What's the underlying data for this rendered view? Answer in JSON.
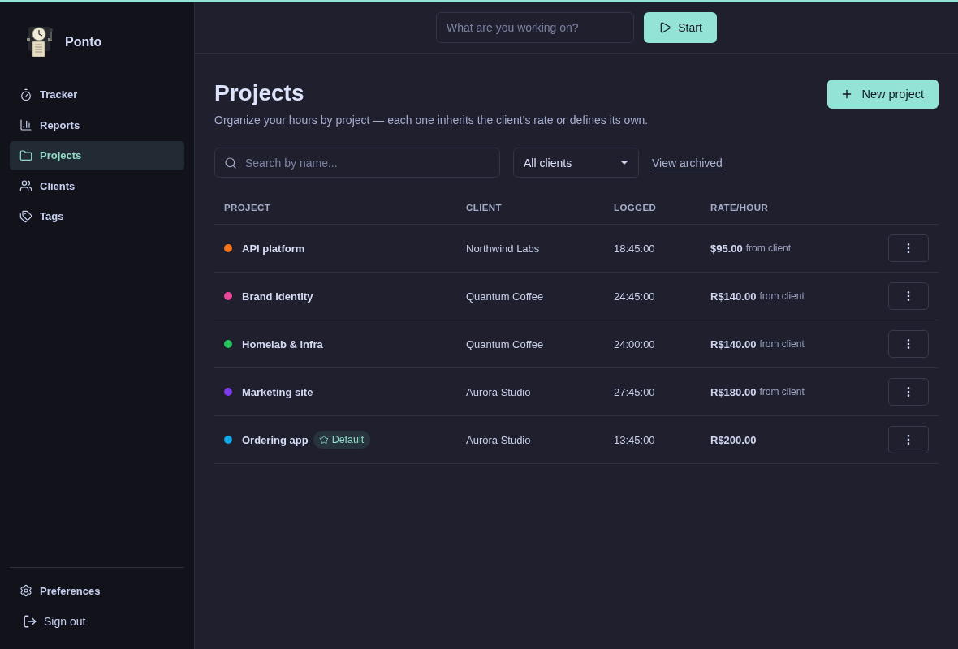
{
  "top_bar": {
    "task_placeholder": "What are you working on?",
    "start_button": "Start"
  },
  "sidebar": {
    "app_name": "Ponto",
    "items": [
      {
        "label": "Tracker",
        "selected": false
      },
      {
        "label": "Reports",
        "selected": false
      },
      {
        "label": "Projects",
        "selected": true
      },
      {
        "label": "Clients",
        "selected": false
      },
      {
        "label": "Tags",
        "selected": false
      }
    ],
    "preferences": "Preferences",
    "sign_out": "Sign out"
  },
  "page": {
    "title": "Projects",
    "subtitle": "Organize your hours by project — each one inherits the client's rate or defines its own.",
    "new_button": "New project"
  },
  "filters": {
    "search_placeholder": "Search by name...",
    "client_filter": "All clients",
    "archived_link": "View archived"
  },
  "table": {
    "columns": [
      "PROJECT",
      "CLIENT",
      "LOGGED",
      "RATE/HOUR"
    ],
    "rows": [
      {
        "name": "API platform",
        "color": "#f97316",
        "client": "Northwind Labs",
        "logged": "18:45:00",
        "rate": "$95.00",
        "rate_note": "from client"
      },
      {
        "name": "Brand identity",
        "color": "#ec4899",
        "client": "Quantum Coffee",
        "logged": "24:45:00",
        "rate": "R$140.00",
        "rate_note": "from client"
      },
      {
        "name": "Homelab & infra",
        "color": "#22c55e",
        "client": "Quantum Coffee",
        "logged": "24:00:00",
        "rate": "R$140.00",
        "rate_note": "from client"
      },
      {
        "name": "Marketing site",
        "color": "#7c3aed",
        "client": "Aurora Studio",
        "logged": "27:45:00",
        "rate": "R$180.00",
        "rate_note": "from client"
      },
      {
        "name": "Ordering app",
        "color": "#0ea5e9",
        "badge": "Default",
        "client": "Aurora Studio",
        "logged": "13:45:00",
        "rate": "R$200.00"
      }
    ]
  }
}
